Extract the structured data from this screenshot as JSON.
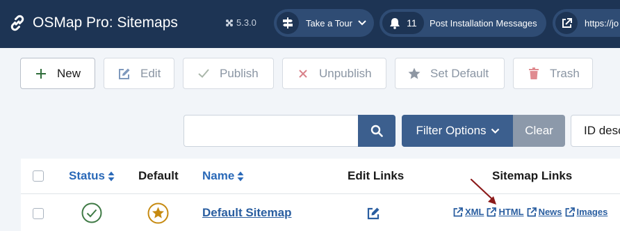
{
  "header": {
    "title": "OSMap Pro: Sitemaps",
    "version": "5.3.0",
    "tour_label": "Take a Tour",
    "post_install_count": "11",
    "post_install_label": "Post Installation Messages",
    "site_link": "https://jo"
  },
  "toolbar": {
    "new_label": "New",
    "edit_label": "Edit",
    "publish_label": "Publish",
    "unpublish_label": "Unpublish",
    "set_default_label": "Set Default",
    "trash_label": "Trash"
  },
  "filters": {
    "search_value": "",
    "filter_options_label": "Filter Options",
    "clear_label": "Clear",
    "sort_value": "ID desc"
  },
  "table": {
    "columns": {
      "status": "Status",
      "default": "Default",
      "name": "Name",
      "edit_links": "Edit Links",
      "sitemap_links": "Sitemap Links"
    },
    "rows": [
      {
        "name": "Default Sitemap",
        "status": "published",
        "is_default": true,
        "links": [
          "XML",
          "HTML",
          "News",
          "Images"
        ]
      }
    ]
  },
  "colors": {
    "header_bg": "#1d3454",
    "primary": "#3c5f8e",
    "link": "#2a5ea0",
    "status_green": "#3f7a45",
    "default_gold": "#c68a10",
    "annotation_arrow": "#8b1a1a"
  }
}
